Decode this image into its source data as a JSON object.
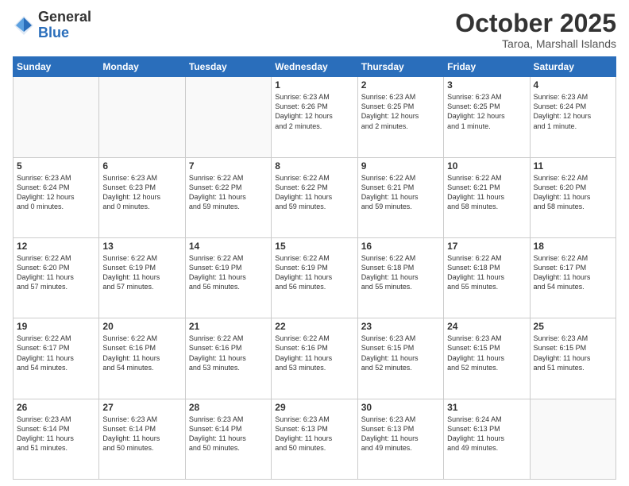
{
  "header": {
    "logo_general": "General",
    "logo_blue": "Blue",
    "month_title": "October 2025",
    "location": "Taroa, Marshall Islands"
  },
  "days_of_week": [
    "Sunday",
    "Monday",
    "Tuesday",
    "Wednesday",
    "Thursday",
    "Friday",
    "Saturday"
  ],
  "weeks": [
    [
      {
        "day": "",
        "info": ""
      },
      {
        "day": "",
        "info": ""
      },
      {
        "day": "",
        "info": ""
      },
      {
        "day": "1",
        "info": "Sunrise: 6:23 AM\nSunset: 6:26 PM\nDaylight: 12 hours\nand 2 minutes."
      },
      {
        "day": "2",
        "info": "Sunrise: 6:23 AM\nSunset: 6:25 PM\nDaylight: 12 hours\nand 2 minutes."
      },
      {
        "day": "3",
        "info": "Sunrise: 6:23 AM\nSunset: 6:25 PM\nDaylight: 12 hours\nand 1 minute."
      },
      {
        "day": "4",
        "info": "Sunrise: 6:23 AM\nSunset: 6:24 PM\nDaylight: 12 hours\nand 1 minute."
      }
    ],
    [
      {
        "day": "5",
        "info": "Sunrise: 6:23 AM\nSunset: 6:24 PM\nDaylight: 12 hours\nand 0 minutes."
      },
      {
        "day": "6",
        "info": "Sunrise: 6:23 AM\nSunset: 6:23 PM\nDaylight: 12 hours\nand 0 minutes."
      },
      {
        "day": "7",
        "info": "Sunrise: 6:22 AM\nSunset: 6:22 PM\nDaylight: 11 hours\nand 59 minutes."
      },
      {
        "day": "8",
        "info": "Sunrise: 6:22 AM\nSunset: 6:22 PM\nDaylight: 11 hours\nand 59 minutes."
      },
      {
        "day": "9",
        "info": "Sunrise: 6:22 AM\nSunset: 6:21 PM\nDaylight: 11 hours\nand 59 minutes."
      },
      {
        "day": "10",
        "info": "Sunrise: 6:22 AM\nSunset: 6:21 PM\nDaylight: 11 hours\nand 58 minutes."
      },
      {
        "day": "11",
        "info": "Sunrise: 6:22 AM\nSunset: 6:20 PM\nDaylight: 11 hours\nand 58 minutes."
      }
    ],
    [
      {
        "day": "12",
        "info": "Sunrise: 6:22 AM\nSunset: 6:20 PM\nDaylight: 11 hours\nand 57 minutes."
      },
      {
        "day": "13",
        "info": "Sunrise: 6:22 AM\nSunset: 6:19 PM\nDaylight: 11 hours\nand 57 minutes."
      },
      {
        "day": "14",
        "info": "Sunrise: 6:22 AM\nSunset: 6:19 PM\nDaylight: 11 hours\nand 56 minutes."
      },
      {
        "day": "15",
        "info": "Sunrise: 6:22 AM\nSunset: 6:19 PM\nDaylight: 11 hours\nand 56 minutes."
      },
      {
        "day": "16",
        "info": "Sunrise: 6:22 AM\nSunset: 6:18 PM\nDaylight: 11 hours\nand 55 minutes."
      },
      {
        "day": "17",
        "info": "Sunrise: 6:22 AM\nSunset: 6:18 PM\nDaylight: 11 hours\nand 55 minutes."
      },
      {
        "day": "18",
        "info": "Sunrise: 6:22 AM\nSunset: 6:17 PM\nDaylight: 11 hours\nand 54 minutes."
      }
    ],
    [
      {
        "day": "19",
        "info": "Sunrise: 6:22 AM\nSunset: 6:17 PM\nDaylight: 11 hours\nand 54 minutes."
      },
      {
        "day": "20",
        "info": "Sunrise: 6:22 AM\nSunset: 6:16 PM\nDaylight: 11 hours\nand 54 minutes."
      },
      {
        "day": "21",
        "info": "Sunrise: 6:22 AM\nSunset: 6:16 PM\nDaylight: 11 hours\nand 53 minutes."
      },
      {
        "day": "22",
        "info": "Sunrise: 6:22 AM\nSunset: 6:16 PM\nDaylight: 11 hours\nand 53 minutes."
      },
      {
        "day": "23",
        "info": "Sunrise: 6:23 AM\nSunset: 6:15 PM\nDaylight: 11 hours\nand 52 minutes."
      },
      {
        "day": "24",
        "info": "Sunrise: 6:23 AM\nSunset: 6:15 PM\nDaylight: 11 hours\nand 52 minutes."
      },
      {
        "day": "25",
        "info": "Sunrise: 6:23 AM\nSunset: 6:15 PM\nDaylight: 11 hours\nand 51 minutes."
      }
    ],
    [
      {
        "day": "26",
        "info": "Sunrise: 6:23 AM\nSunset: 6:14 PM\nDaylight: 11 hours\nand 51 minutes."
      },
      {
        "day": "27",
        "info": "Sunrise: 6:23 AM\nSunset: 6:14 PM\nDaylight: 11 hours\nand 50 minutes."
      },
      {
        "day": "28",
        "info": "Sunrise: 6:23 AM\nSunset: 6:14 PM\nDaylight: 11 hours\nand 50 minutes."
      },
      {
        "day": "29",
        "info": "Sunrise: 6:23 AM\nSunset: 6:13 PM\nDaylight: 11 hours\nand 50 minutes."
      },
      {
        "day": "30",
        "info": "Sunrise: 6:23 AM\nSunset: 6:13 PM\nDaylight: 11 hours\nand 49 minutes."
      },
      {
        "day": "31",
        "info": "Sunrise: 6:24 AM\nSunset: 6:13 PM\nDaylight: 11 hours\nand 49 minutes."
      },
      {
        "day": "",
        "info": ""
      }
    ]
  ]
}
